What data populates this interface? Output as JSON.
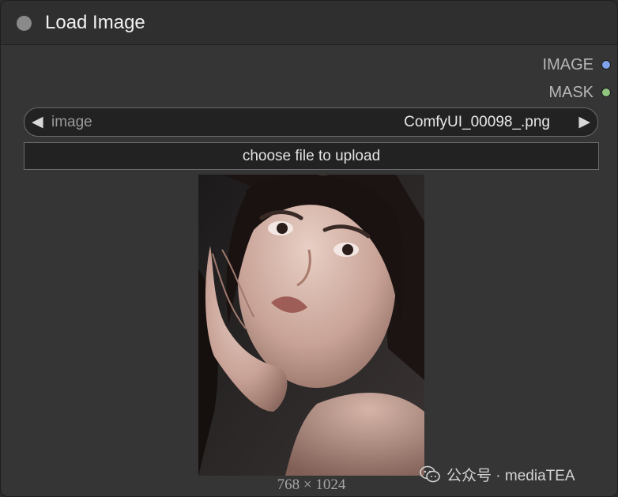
{
  "node": {
    "title": "Load Image",
    "outputs": [
      {
        "label": "IMAGE",
        "color": "#7ea3ea"
      },
      {
        "label": "MASK",
        "color": "#91c47f"
      }
    ]
  },
  "image_combo": {
    "label": "image",
    "value": "ComfyUI_00098_.png",
    "prev_icon": "left-triangle",
    "next_icon": "right-triangle"
  },
  "upload_button": {
    "label": "choose file to upload"
  },
  "preview": {
    "dimensions": "768 × 1024"
  },
  "watermark": {
    "text": "公众号 · mediaTEA"
  }
}
